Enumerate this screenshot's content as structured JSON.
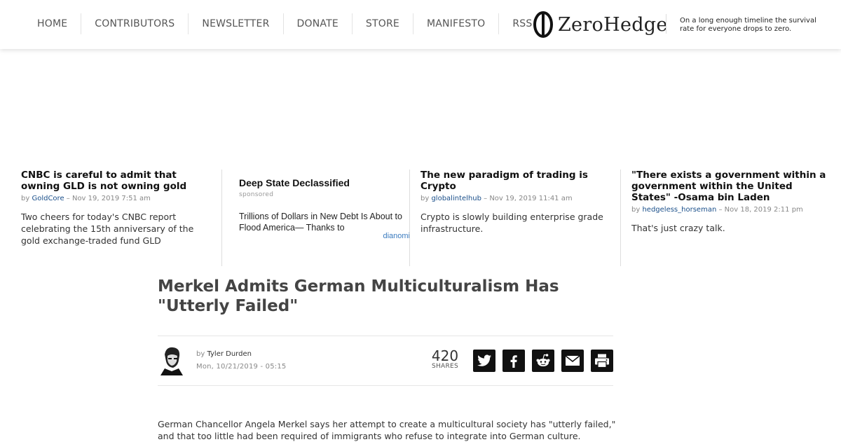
{
  "nav": {
    "items": [
      "HOME",
      "CONTRIBUTORS",
      "NEWSLETTER",
      "DONATE",
      "STORE",
      "MANIFESTO",
      "RSS"
    ]
  },
  "logo": {
    "text": "ZeroHedge",
    "icon": "theta-logo-icon"
  },
  "tagline": "On a long enough timeline the survival rate for everyone drops to zero.",
  "teasers": [
    {
      "title": "CNBC is careful to admit that owning GLD is not owning gold",
      "by": "by",
      "author": "GoldCore",
      "date": "– Nov 19, 2019 7:51 am",
      "body": "Two cheers for today's CNBC report celebrating the 15th anniversary of the gold exchange-traded fund GLD"
    },
    {
      "title": "Deep State Declassified",
      "label": "sponsored",
      "body": "Trillions of Dollars in New Debt Is About to Flood America— Thanks to",
      "brand": "dianomi"
    },
    {
      "title": "The new paradigm of trading is Crypto",
      "by": "by",
      "author": "globalintelhub",
      "date": "– Nov 19, 2019 11:41 am",
      "body": "Crypto is slowly building enterprise grade infrastructure."
    },
    {
      "title": "\"There exists a government within a government within the United States\" -Osama bin Laden",
      "by": "by",
      "author": "hedgeless_horseman",
      "date": "– Nov 18, 2019 2:11 pm",
      "body": "That's just crazy talk."
    }
  ],
  "article": {
    "headline": "Merkel Admits German Multiculturalism Has \"Utterly Failed\"",
    "by": "by",
    "author": "Tyler Durden",
    "date": "Mon, 10/21/2019 - 05:15",
    "shares_count": "420",
    "shares_label": "SHARES",
    "share_icons": [
      "twitter-icon",
      "facebook-icon",
      "reddit-icon",
      "email-icon",
      "print-icon"
    ],
    "body": "German Chancellor Angela Merkel says her attempt to create a multicultural society has \"utterly failed,\" and that too little had been required of immigrants who refuse to integrate into German culture."
  }
}
